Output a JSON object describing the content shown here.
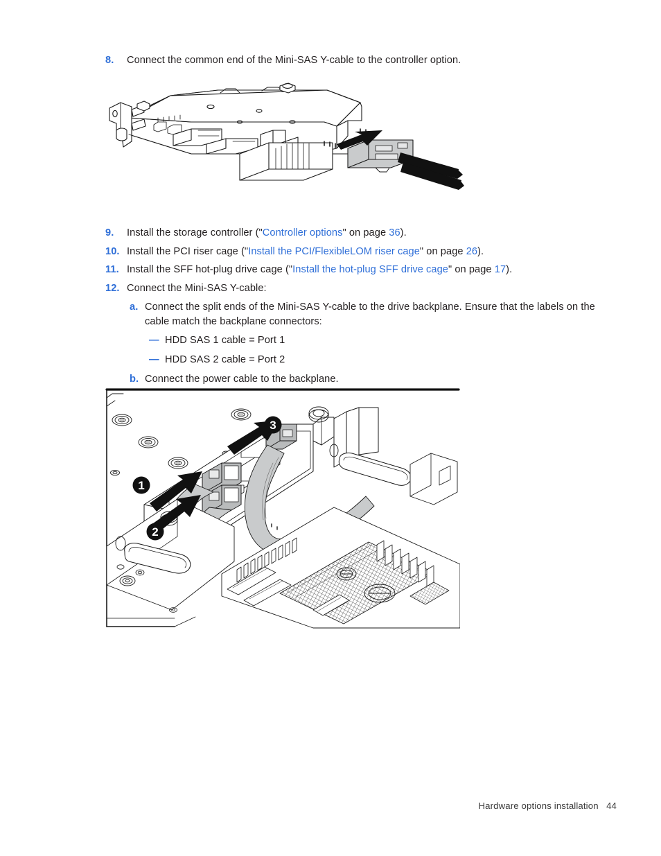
{
  "document": {
    "footer_text": "Hardware options installation",
    "page_number": "44",
    "link_color": "#2f6fd8",
    "text_color": "#231f20"
  },
  "steps": {
    "s8": {
      "number": "8.",
      "text": "Connect the common end of the Mini-SAS Y-cable to the controller option."
    },
    "s9": {
      "number": "9.",
      "pre": "Install the storage controller (\"",
      "link": "Controller options",
      "mid": "\" on page ",
      "page": "36",
      "post": ")."
    },
    "s10": {
      "number": "10.",
      "pre": "Install the PCI riser cage (\"",
      "link": "Install the PCI/FlexibleLOM riser cage",
      "mid": "\" on page ",
      "page": "26",
      "post": ")."
    },
    "s11": {
      "number": "11.",
      "pre": "Install the SFF hot-plug drive cage (\"",
      "link": "Install the hot-plug SFF drive cage",
      "mid": "\" on page ",
      "page": "17",
      "post": ")."
    },
    "s12": {
      "number": "12.",
      "text": "Connect the Mini-SAS Y-cable:"
    },
    "s12a": {
      "number": "a.",
      "text": "Connect the split ends of the Mini-SAS Y-cable to the drive backplane. Ensure that the labels on the cable match the backplane connectors:"
    },
    "s12a_dash1": {
      "bullet": "—",
      "text": "HDD SAS 1 cable = Port 1"
    },
    "s12a_dash2": {
      "bullet": "—",
      "text": "HDD SAS 2 cable = Port 2"
    },
    "s12b": {
      "number": "b.",
      "text": "Connect the power cable to the backplane."
    }
  },
  "figures": {
    "controller_card": {
      "caption": "",
      "alt_name": "pcie-storage-controller-with-mini-sas-y-cable"
    },
    "chassis_interior": {
      "caption": "",
      "alt_name": "server-chassis-interior-cable-routing",
      "callouts": [
        {
          "id": "1",
          "label": "1"
        },
        {
          "id": "2",
          "label": "2"
        },
        {
          "id": "3",
          "label": "3"
        }
      ]
    }
  }
}
